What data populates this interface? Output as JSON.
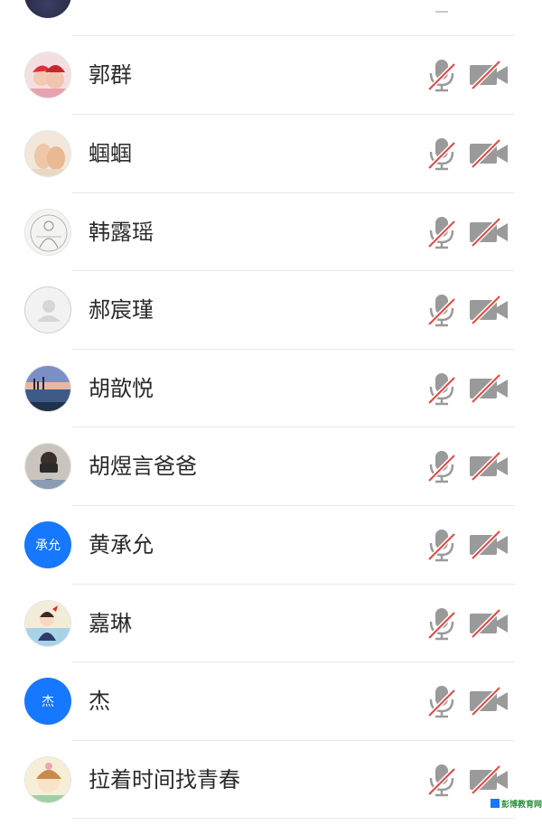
{
  "participants": [
    {
      "name": "郭群",
      "avatar": "photo-two-girls",
      "mic": "muted",
      "camera": "off"
    },
    {
      "name": "蝈蝈",
      "avatar": "photo-baby-feet",
      "mic": "muted",
      "camera": "off"
    },
    {
      "name": "韩露瑶",
      "avatar": "photo-buddha-sketch",
      "mic": "muted",
      "camera": "off"
    },
    {
      "name": "郝宸瑾",
      "avatar": "default-person",
      "mic": "muted",
      "camera": "off"
    },
    {
      "name": "胡歆悦",
      "avatar": "photo-lake-sunset",
      "mic": "muted",
      "camera": "off"
    },
    {
      "name": "胡煜言爸爸",
      "avatar": "photo-person-camera",
      "mic": "muted",
      "camera": "off"
    },
    {
      "name": "黄承允",
      "avatar_text": "承允",
      "mic": "muted",
      "camera": "off"
    },
    {
      "name": "嘉琳",
      "avatar": "photo-cartoon-girl",
      "mic": "muted",
      "camera": "off"
    },
    {
      "name": "杰",
      "avatar_text": "杰",
      "mic": "muted",
      "camera": "off"
    },
    {
      "name": "拉着时间找青春",
      "avatar": "photo-cartoon-girl-hat",
      "mic": "muted",
      "camera": "off"
    }
  ],
  "colors": {
    "text_avatar_bg": "#1677ff",
    "icon_gray": "#9a9a9a",
    "slash_red": "#e5483f"
  },
  "watermark": {
    "text": "彭博教育网"
  }
}
